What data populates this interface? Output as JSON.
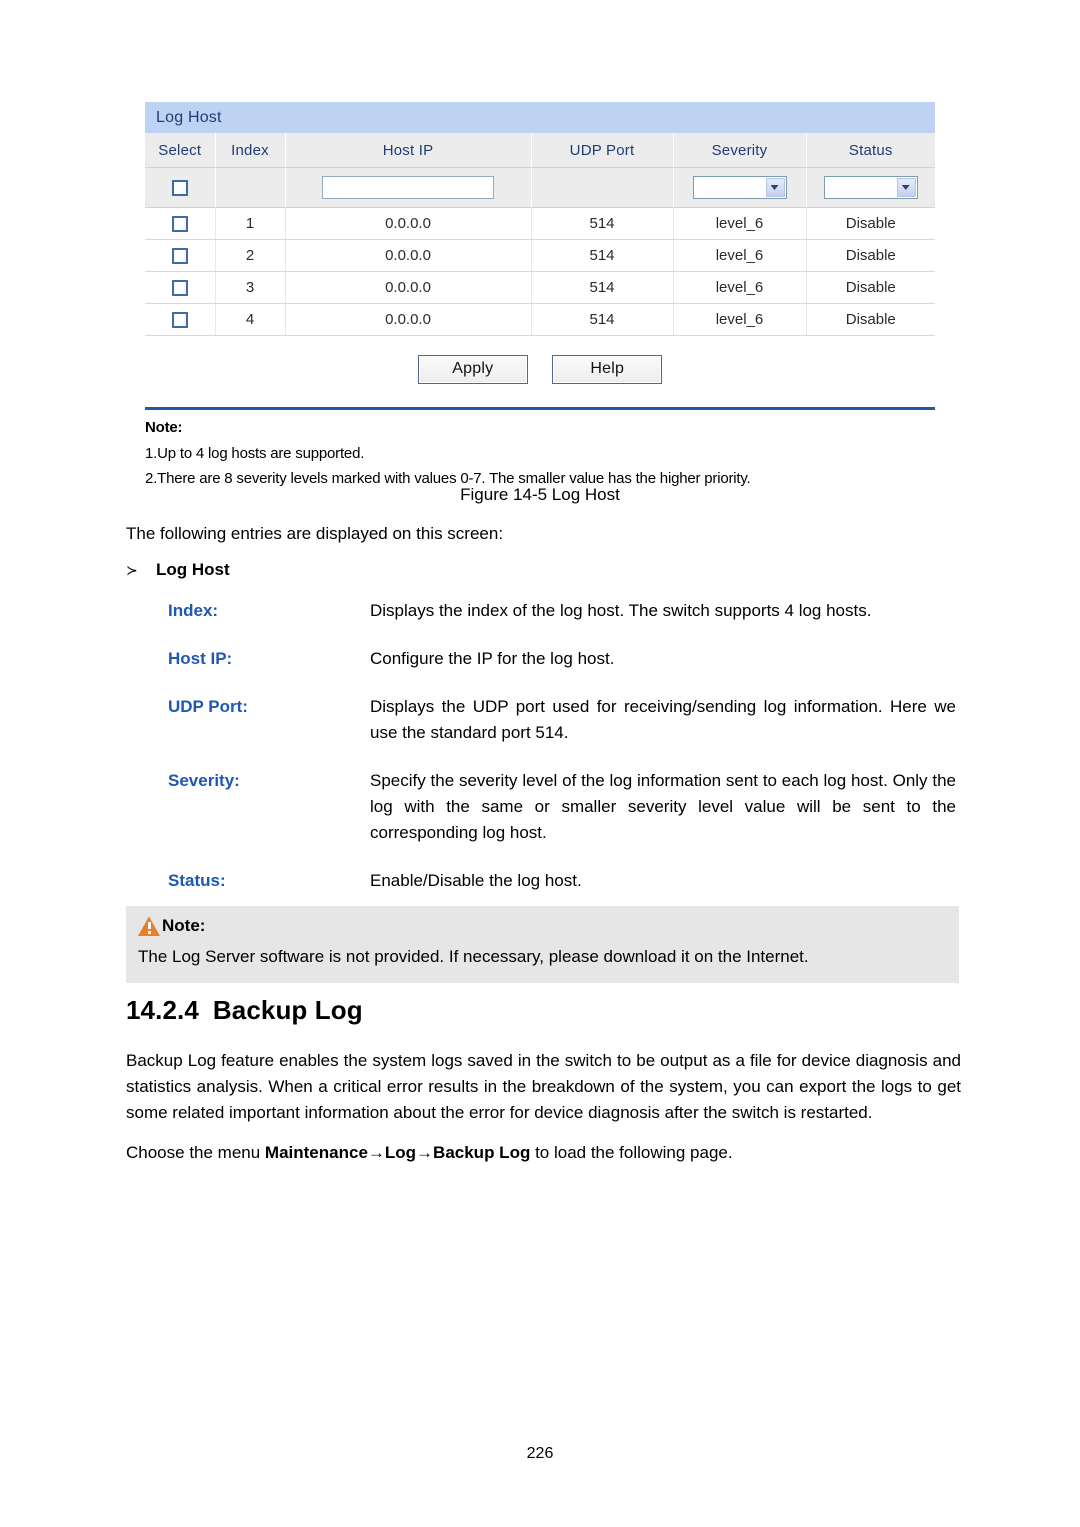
{
  "screenshot": {
    "panel_title": "Log Host",
    "columns": [
      "Select",
      "Index",
      "Host IP",
      "UDP Port",
      "Severity",
      "Status"
    ],
    "form_row": {
      "host_ip_value": "",
      "host_ip_placeholder": "",
      "severity_value": "",
      "status_value": ""
    },
    "rows": [
      {
        "index": "1",
        "host_ip": "0.0.0.0",
        "udp_port": "514",
        "severity": "level_6",
        "status": "Disable"
      },
      {
        "index": "2",
        "host_ip": "0.0.0.0",
        "udp_port": "514",
        "severity": "level_6",
        "status": "Disable"
      },
      {
        "index": "3",
        "host_ip": "0.0.0.0",
        "udp_port": "514",
        "severity": "level_6",
        "status": "Disable"
      },
      {
        "index": "4",
        "host_ip": "0.0.0.0",
        "udp_port": "514",
        "severity": "level_6",
        "status": "Disable"
      }
    ],
    "buttons": {
      "apply": "Apply",
      "help": "Help"
    },
    "note": {
      "heading": "Note:",
      "lines": [
        "1.Up to 4 log hosts are supported.",
        "2.There are 8 severity levels marked with values 0-7. The smaller value has the higher priority."
      ]
    },
    "colors": {
      "panel_header_bg": "#bed3f3",
      "panel_header_text": "#1f3c77",
      "column_header_bg": "#ececec",
      "divider": "#1f5aa0"
    }
  },
  "document": {
    "figure_caption": "Figure 14-5 Log Host",
    "intro": "The following entries are displayed on this screen:",
    "bullet": {
      "marker": "≻",
      "label": "Log Host"
    },
    "definitions": [
      {
        "term": "Index:",
        "desc": "Displays the index of the log host. The switch supports 4 log hosts."
      },
      {
        "term": "Host IP:",
        "desc": "Configure the IP for the log host."
      },
      {
        "term": "UDP Port:",
        "desc": "Displays the UDP port used for receiving/sending log information. Here we use the standard port 514."
      },
      {
        "term": "Severity:",
        "desc": "Specify the severity level of the log information sent to each log host. Only the log with the same or smaller severity level value will be sent to the corresponding log host."
      },
      {
        "term": "Status:",
        "desc": "Enable/Disable the log host."
      }
    ],
    "note_box": {
      "icon": "warning-triangle-icon",
      "label": "Note:",
      "body": "The Log Server software is not provided. If necessary, please download it on the Internet.",
      "accent": "#e8802b",
      "bg": "#e6e6e6"
    },
    "section": {
      "number": "14.2.4",
      "title": "Backup Log",
      "paragraph": "Backup Log feature enables the system logs saved in the switch to be output as a file for device diagnosis and statistics analysis. When a critical error results in the breakdown of the system, you can export the logs to get some related important information about the error for device diagnosis after the switch is restarted.",
      "choose_prefix": "Choose the menu ",
      "choose_path": "Maintenance→Log→Backup Log",
      "choose_suffix": " to load the following page."
    },
    "term_color": "#1f57b5",
    "page_number": "226"
  }
}
